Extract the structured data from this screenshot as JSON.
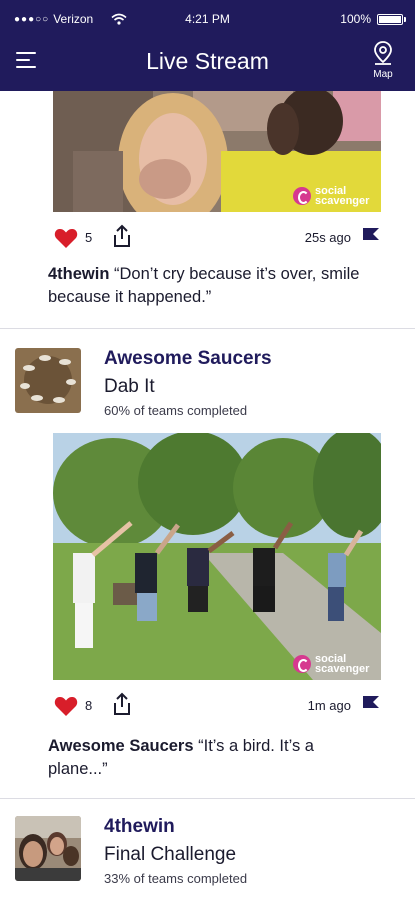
{
  "status_bar": {
    "carrier": "Verizon",
    "time": "4:21 PM",
    "battery": "100%"
  },
  "header": {
    "title": "Live Stream",
    "map_label": "Map"
  },
  "colors": {
    "header_bg": "#201b5c",
    "accent": "#201b5c",
    "like_red": "#d81e2a",
    "brand_pink": "#d6398f"
  },
  "posts": [
    {
      "likes": "5",
      "time_ago": "25s ago",
      "brand": "social scavenger",
      "caption_team": "4thewin",
      "caption_text": " “Don’t cry because it’s over, smile because it happened.”"
    },
    {
      "team": "Awesome Saucers",
      "challenge": "Dab It",
      "progress": "60% of teams completed",
      "likes": "8",
      "time_ago": "1m ago",
      "brand": "social scavenger",
      "caption_team": "Awesome Saucers",
      "caption_text": " “It’s a bird. It’s a plane...”"
    },
    {
      "team": "4thewin",
      "challenge": "Final Challenge",
      "progress": "33% of teams completed"
    }
  ],
  "icons": [
    "wifi-icon",
    "battery-icon",
    "hamburger-menu-icon",
    "map-pin-icon",
    "heart-icon",
    "share-icon",
    "flag-icon"
  ]
}
